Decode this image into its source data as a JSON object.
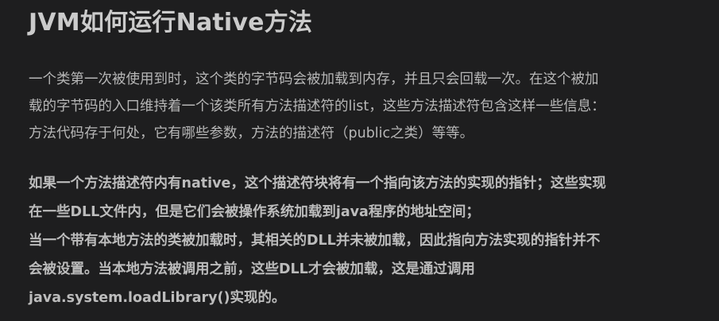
{
  "article": {
    "title": "JVM如何运行Native方法",
    "paragraph1": [
      "一个类第一次被使用到时，这个类的字节码会被加载到内存，并且只会回载一次。在这个被加",
      "载的字节码的入口维持着一个该类所有方法描述符的list，这些方法描述符包含这样一些信息：",
      "方法代码存于何处，它有哪些参数，方法的描述符（public之类）等等。"
    ],
    "paragraph2": [
      "如果一个方法描述符内有native，这个描述符块将有一个指向该方法的实现的指针；这些实现",
      "在一些DLL文件内，但是它们会被操作系统加载到java程序的地址空间；",
      "当一个带有本地方法的类被加载时，其相关的DLL并未被加载，因此指向方法实现的指针并不",
      "会被设置。当本地方法被调用之前，这些DLL才会被加载，这是通过调用",
      "java.system.loadLibrary()实现的。"
    ]
  }
}
